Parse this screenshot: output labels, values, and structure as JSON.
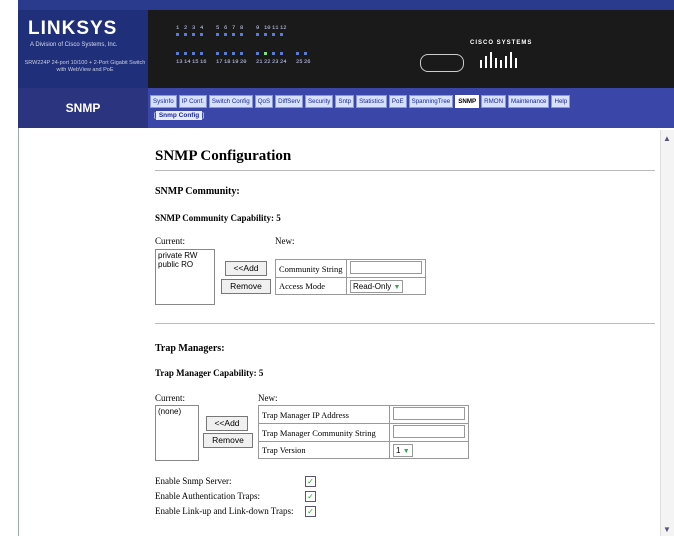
{
  "brand": {
    "logo": "LINKSYS",
    "division": "A Division of Cisco Systems, Inc.",
    "model": "SRW224P 24-port 10/100 + 2-Port Gigabit Switch with WebView and PoE",
    "cisco": "CISCO SYSTEMS"
  },
  "ports": {
    "top_numbers": [
      "1",
      "2",
      "3",
      "4",
      "",
      "5",
      "6",
      "7",
      "8",
      "",
      "9",
      "10",
      "11",
      "12"
    ],
    "bottom_numbers": [
      "13",
      "14",
      "15",
      "16",
      "",
      "17",
      "18",
      "19",
      "20",
      "",
      "21",
      "22",
      "23",
      "24",
      "",
      "25",
      "26"
    ]
  },
  "nav": {
    "page_label": "SNMP",
    "tabs": [
      "SysInfo",
      "IP Conf.",
      "Switch Config",
      "QoS",
      "DiffServ",
      "Security",
      "Sntp",
      "Statistics",
      "PoE",
      "SpanningTree",
      "SNMP",
      "RMON",
      "Maintenance",
      "Help"
    ],
    "active_tab": "SNMP",
    "subnav": "Snmp Config"
  },
  "main": {
    "title": "SNMP Configuration",
    "community": {
      "heading": "SNMP Community:",
      "capability": "SNMP Community Capability: 5",
      "current_label": "Current:",
      "new_label": "New:",
      "current_items": [
        "private RW",
        "public RO"
      ],
      "add_button": "<<Add",
      "remove_button": "Remove",
      "field_community": "Community String",
      "field_access": "Access Mode",
      "community_value": "",
      "access_value": "Read-Only"
    },
    "traps": {
      "heading": "Trap Managers:",
      "capability": "Trap Manager Capability: 5",
      "current_label": "Current:",
      "new_label": "New:",
      "current_items": [
        "(none)"
      ],
      "add_button": "<<Add",
      "remove_button": "Remove",
      "field_ip": "Trap Manager IP Address",
      "field_community": "Trap Manager Community String",
      "field_version": "Trap Version",
      "ip_value": "",
      "community_value": "",
      "version_value": "1"
    },
    "options": {
      "snmp_server": "Enable Snmp Server:",
      "auth_traps": "Enable Authentication Traps:",
      "link_traps": "Enable Link-up and Link-down Traps:",
      "snmp_server_checked": true,
      "auth_traps_checked": true,
      "link_traps_checked": true
    }
  },
  "colors": {
    "header_bg": "#1a1a1a",
    "nav_bg": "#3a46a8",
    "logo_bg": "#1f2f7a"
  }
}
